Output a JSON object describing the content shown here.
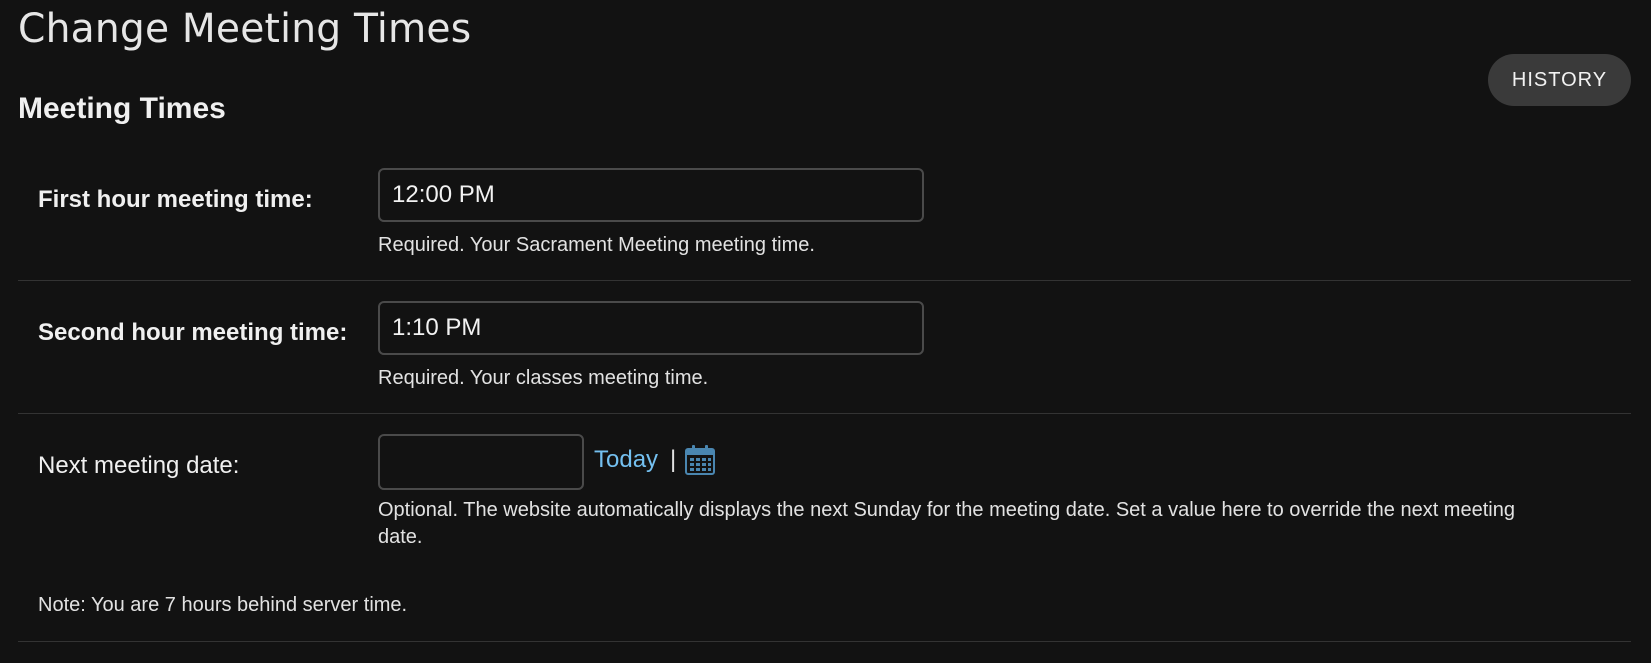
{
  "page": {
    "title": "Change Meeting Times",
    "history_button": "HISTORY",
    "section_title": "Meeting Times"
  },
  "form": {
    "first_hour": {
      "label": "First hour meeting time:",
      "value": "12:00 PM",
      "help": "Required. Your Sacrament Meeting meeting time."
    },
    "second_hour": {
      "label": "Second hour meeting time:",
      "value": "1:10 PM",
      "help": "Required. Your classes meeting time."
    },
    "next_meeting_date": {
      "label": "Next meeting date:",
      "value": "",
      "today_link": "Today",
      "separator": "|",
      "calendar_icon": "calendar-icon",
      "help": "Optional. The website automatically displays the next Sunday for the meeting date. Set a value here to override the next meeting date."
    },
    "note": "Note: You are 7 hours behind server time."
  },
  "colors": {
    "background": "#121212",
    "link": "#74c0f0",
    "calendar_icon": "#4a86b0",
    "button_bg": "#3a3a3a"
  }
}
